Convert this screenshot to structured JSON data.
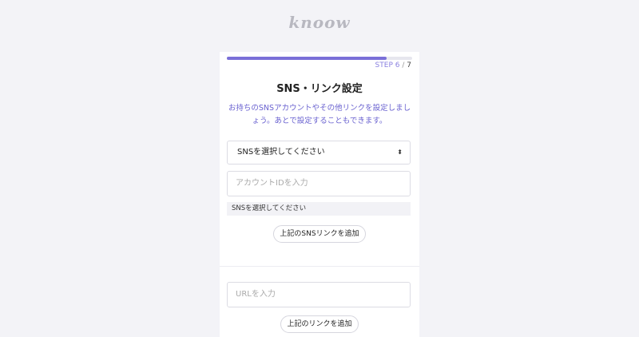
{
  "logo": {
    "text": "knoow"
  },
  "progress": {
    "fraction": 0.86
  },
  "step": {
    "label": "STEP 6",
    "sep": "/",
    "total": "7"
  },
  "form": {
    "title": "SNS・リンク設定",
    "description": "お持ちのSNSアカウントやその他リンクを設定しましょう。あとで設定することもできます。",
    "sns_select": {
      "value": "SNSを選択してください",
      "arrows": "⬍"
    },
    "account_input": {
      "placeholder": "アカウントIDを入力"
    },
    "sns_hint": "SNSを選択してください",
    "add_sns_button": "上記のSNSリンクを追加",
    "url_input": {
      "placeholder": "URLを入力"
    },
    "add_link_button": "上記のリンクを追加"
  }
}
